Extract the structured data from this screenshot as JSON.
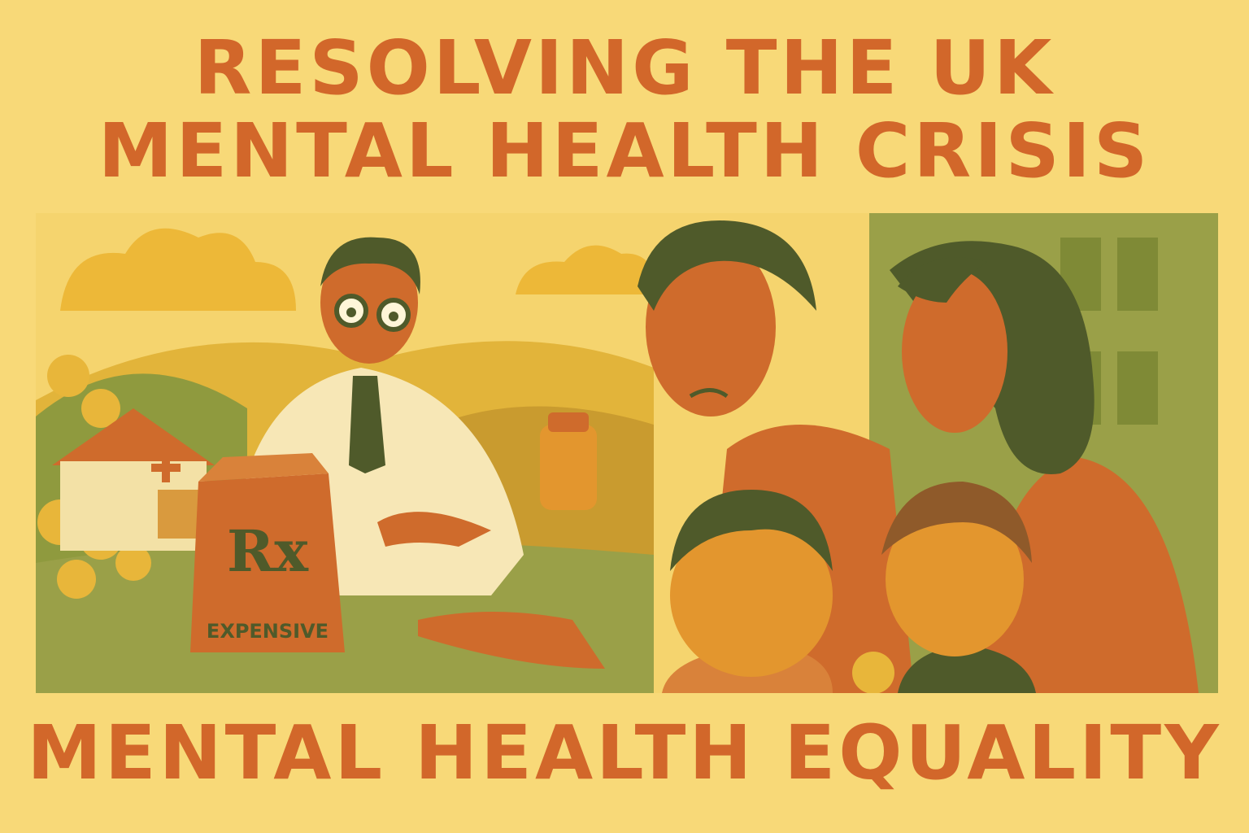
{
  "poster": {
    "title_line_1": "RESOLVING THE UK",
    "title_line_2": "MENTAL HEALTH CRISIS",
    "footer": "MENTAL HEALTH EQUALITY"
  },
  "illustration": {
    "bag_symbol": "Rx",
    "bag_label": "EXPENSIVE",
    "figures": [
      "doctor",
      "sad-man",
      "worried-woman",
      "boy",
      "girl"
    ]
  },
  "colors": {
    "background": "#f8d978",
    "title": "#d2672a",
    "orange": "#cf6b2c",
    "olive": "#8f9a3e",
    "dark-green": "#4f5a2a",
    "mustard": "#e8b63a"
  }
}
